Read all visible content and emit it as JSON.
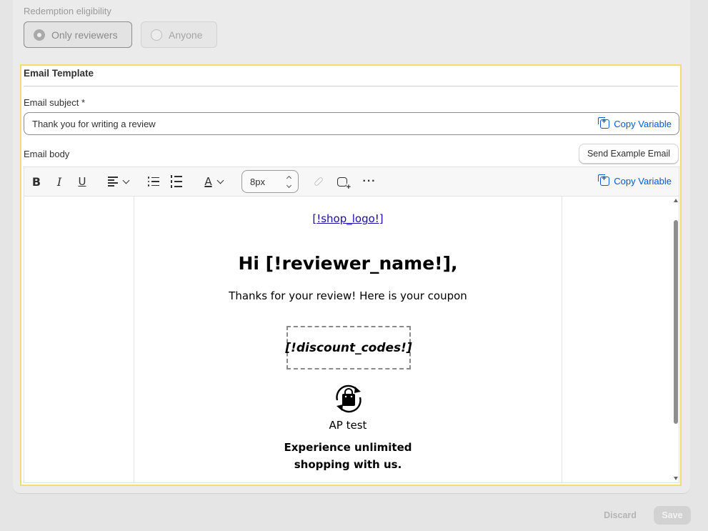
{
  "eligibility": {
    "label": "Redemption eligibility",
    "options": [
      {
        "label": "Only reviewers",
        "selected": true
      },
      {
        "label": "Anyone",
        "selected": false
      }
    ]
  },
  "template": {
    "title": "Email Template",
    "subject_label": "Email subject",
    "subject_required": "*",
    "subject_value": "Thank you for writing a review",
    "copy_variable": "Copy Variable",
    "body_label": "Email body",
    "send_example": "Send Example Email"
  },
  "toolbar": {
    "bold": "B",
    "italic": "I",
    "underline": "U",
    "text_color": "A",
    "font_size": "8px",
    "more": "···",
    "copy_variable": "Copy Variable"
  },
  "email": {
    "shop_logo": "[!shop_logo!]",
    "greeting": "Hi [!reviewer_name!],",
    "thanks": "Thanks for your review! Here is your coupon",
    "coupon": "[!discount_codes!]",
    "shop_name": "AP test",
    "tagline_line1": "Experience unlimited",
    "tagline_line2": "shopping with us."
  },
  "footer": {
    "discard": "Discard",
    "save": "Save"
  },
  "icons": [
    "bold-icon",
    "italic-icon",
    "underline-icon",
    "align-left-icon",
    "bullet-list-icon",
    "numbered-list-icon",
    "text-color-icon",
    "link-icon",
    "insert-image-icon",
    "more-icon",
    "copy-icon",
    "shopping-bag-icon"
  ],
  "colors": {
    "accent_blue": "#005bd3",
    "focus_border": "#f3dd72",
    "link": "#1a0dab"
  }
}
